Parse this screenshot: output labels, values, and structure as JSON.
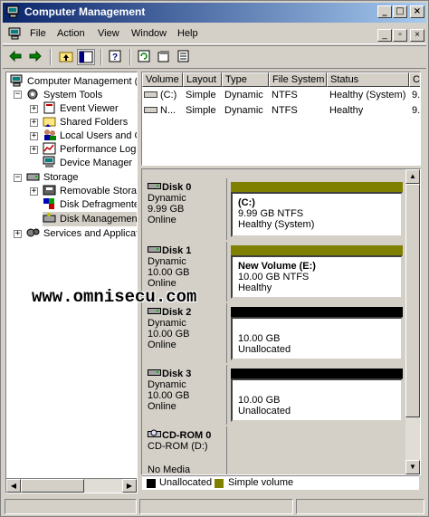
{
  "window": {
    "title": "Computer Management"
  },
  "menu": [
    {
      "label": "File",
      "key": "F"
    },
    {
      "label": "Action",
      "key": "A"
    },
    {
      "label": "View",
      "key": "V"
    },
    {
      "label": "Window",
      "key": "W"
    },
    {
      "label": "Help",
      "key": "H"
    }
  ],
  "tree": {
    "root": "Computer Management (L",
    "system_tools": "System Tools",
    "event_viewer": "Event Viewer",
    "shared_folders": "Shared Folders",
    "local_users": "Local Users and Gr",
    "performance_logs": "Performance Logs",
    "device_manager": "Device Manager",
    "storage": "Storage",
    "removable_storage": "Removable Storag",
    "disk_defragmenter": "Disk Defragmente",
    "disk_management": "Disk Management",
    "services": "Services and Applicatio"
  },
  "volume_list": {
    "columns": [
      "Volume",
      "Layout",
      "Type",
      "File System",
      "Status",
      "Ca"
    ],
    "rows": [
      [
        "(C:)",
        "Simple",
        "Dynamic",
        "NTFS",
        "Healthy (System)",
        "9."
      ],
      [
        "N...",
        "Simple",
        "Dynamic",
        "NTFS",
        "Healthy",
        "9."
      ]
    ]
  },
  "disks": [
    {
      "name": "Disk 0",
      "type": "Dynamic",
      "size": "9.99 GB",
      "status": "Online",
      "volume": {
        "title": "(C:)",
        "detail": "9.99 GB NTFS",
        "state": "Healthy (System)",
        "kind": "simple"
      }
    },
    {
      "name": "Disk 1",
      "type": "Dynamic",
      "size": "10.00 GB",
      "status": "Online",
      "volume": {
        "title": "New Volume  (E:)",
        "detail": "10.00 GB NTFS",
        "state": "Healthy",
        "kind": "simple"
      }
    },
    {
      "name": "Disk 2",
      "type": "Dynamic",
      "size": "10.00 GB",
      "status": "Online",
      "volume": {
        "title": "",
        "detail": "10.00 GB",
        "state": "Unallocated",
        "kind": "unallocated"
      }
    },
    {
      "name": "Disk 3",
      "type": "Dynamic",
      "size": "10.00 GB",
      "status": "Online",
      "volume": {
        "title": "",
        "detail": "10.00 GB",
        "state": "Unallocated",
        "kind": "unallocated"
      }
    }
  ],
  "cdrom": {
    "name": "CD-ROM 0",
    "drive": "CD-ROM (D:)",
    "media": "No Media"
  },
  "legend": {
    "unallocated": "Unallocated",
    "simple": "Simple volume"
  },
  "colors": {
    "simple": "#808000",
    "unallocated": "#000000",
    "selection": "#d4d0c8",
    "title_start": "#0a246a"
  },
  "watermark": "www.omnisecu.com"
}
